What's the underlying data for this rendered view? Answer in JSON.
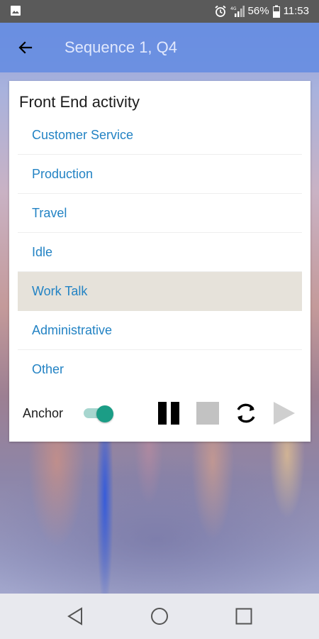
{
  "status_bar": {
    "battery": "56%",
    "time": "11:53",
    "icons": [
      "gallery-icon",
      "alarm-icon",
      "signal-icon",
      "battery-icon"
    ]
  },
  "app_bar": {
    "title": "Sequence 1, Q4",
    "back_icon": "back-arrow-icon"
  },
  "card": {
    "heading": "Front End activity",
    "items": [
      {
        "label": "Customer Service",
        "selected": false
      },
      {
        "label": "Production",
        "selected": false
      },
      {
        "label": "Travel",
        "selected": false
      },
      {
        "label": "Idle",
        "selected": false
      },
      {
        "label": "Work Talk",
        "selected": true
      },
      {
        "label": "Administrative",
        "selected": false
      },
      {
        "label": "Other",
        "selected": false
      }
    ],
    "controls": {
      "anchor_label": "Anchor",
      "anchor_on": true,
      "icons": [
        "pause-icon",
        "stop-icon",
        "refresh-icon",
        "play-icon"
      ]
    }
  },
  "nav_bar": {
    "icons": [
      "nav-back-icon",
      "home-icon",
      "recents-icon"
    ]
  },
  "colors": {
    "app_bar": "#648ce1",
    "list_text": "#2383c4",
    "selected_row": "#e6e2da",
    "toggle_thumb": "#1b9d86",
    "toggle_track": "#a7d6cf"
  }
}
